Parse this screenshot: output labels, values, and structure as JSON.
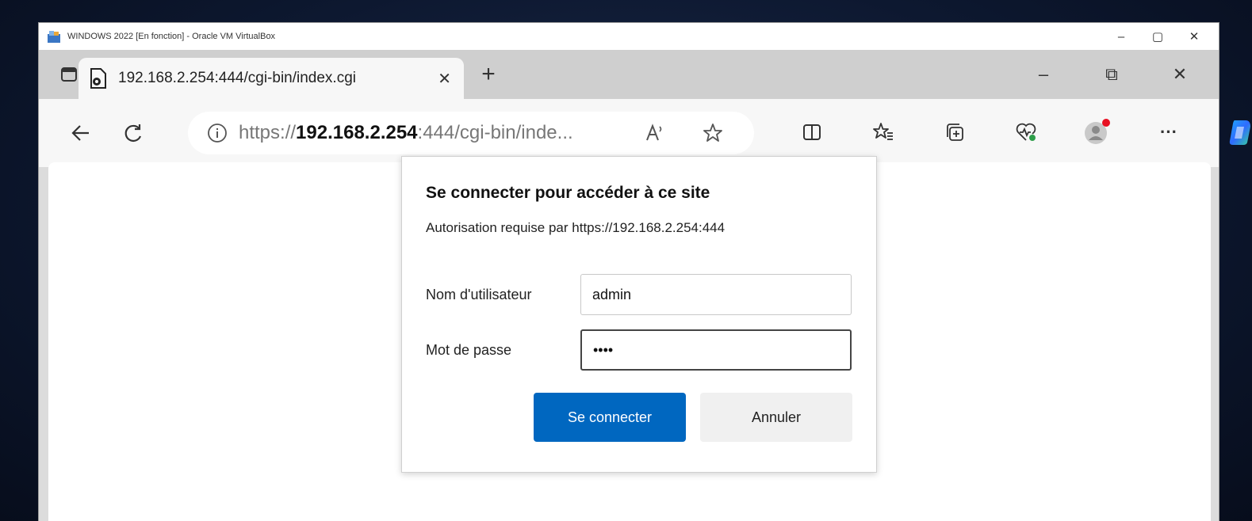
{
  "vbox": {
    "title": "WINDOWS 2022 [En fonction] - Oracle VM VirtualBox",
    "minimize": "–",
    "maximize": "▢",
    "close": "✕"
  },
  "browser": {
    "tab": {
      "title": "192.168.2.254:444/cgi-bin/index.cgi",
      "close": "✕"
    },
    "new_tab": "+",
    "window_controls": {
      "minimize": "–",
      "restore": "⧉",
      "close": "✕"
    },
    "address": {
      "scheme": "https://",
      "host": "192.168.2.254",
      "rest": ":444/cgi-bin/inde..."
    },
    "more": "···"
  },
  "auth_dialog": {
    "title": "Se connecter pour accéder à ce site",
    "subtitle": "Autorisation requise par https://192.168.2.254:444",
    "username_label": "Nom d'utilisateur",
    "username_value": "admin",
    "password_label": "Mot de passe",
    "password_value": "••••",
    "submit_label": "Se connecter",
    "cancel_label": "Annuler"
  },
  "colors": {
    "accent": "#0067c0",
    "profile_dot": "#e81123"
  }
}
